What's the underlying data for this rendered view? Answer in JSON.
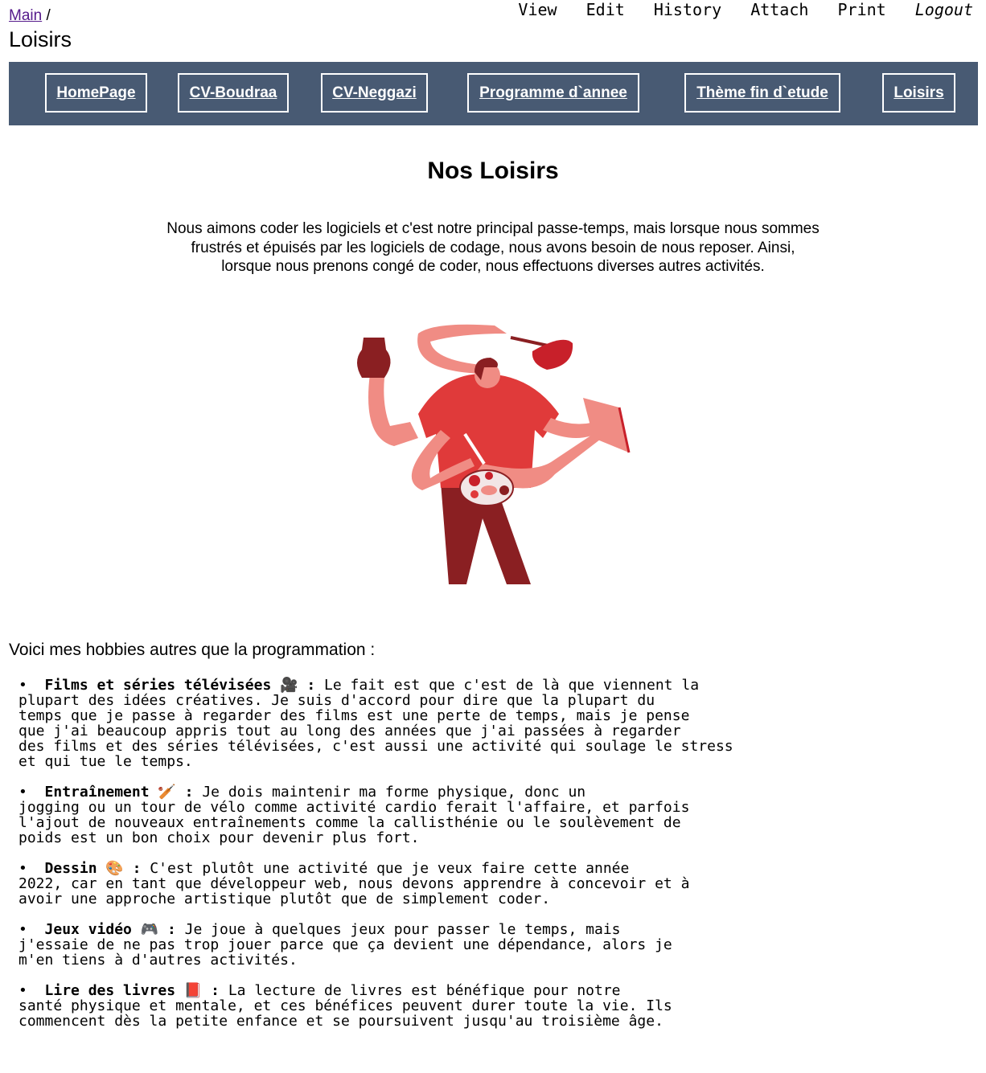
{
  "breadcrumb": {
    "root": "Main",
    "sep": " /"
  },
  "page_title": "Loisirs",
  "actions": [
    "View",
    "Edit",
    "History",
    "Attach",
    "Print",
    "Logout"
  ],
  "nav": [
    "HomePage",
    "CV-Boudraa",
    "CV-Neggazi",
    "Programme d`annee",
    "Thème fin d`etude",
    "Loisirs"
  ],
  "heading": "Nos Loisirs",
  "intro": [
    "Nous aimons coder les logiciels et c'est notre principal passe-temps, mais lorsque nous sommes",
    "frustrés et épuisés par les logiciels de codage, nous avons besoin de nous reposer. Ainsi,",
    "lorsque nous prenons congé de coder, nous effectuons diverses autres activités."
  ],
  "lead": "Voici mes hobbies autres que la programmation :",
  "hobbies": [
    {
      "title": "Films et séries télévisées 🎥 :",
      "lines": [
        " Le fait est que c'est de là que viennent la",
        "plupart des idées créatives. Je suis d'accord pour dire que la plupart du",
        "temps que je passe à regarder des films est une perte de temps, mais je pense",
        "que j'ai beaucoup appris tout au long des années que j'ai passées à regarder",
        "des films et des séries télévisées, c'est aussi une activité qui soulage le stress",
        "et qui tue le temps."
      ]
    },
    {
      "title": "Entraînement 🏏 :",
      "lines": [
        " Je dois maintenir ma forme physique, donc un",
        "jogging ou un tour de vélo comme activité cardio ferait l'affaire, et parfois",
        "l'ajout de nouveaux entraînements comme la callisthénie ou le soulèvement de",
        "poids est un bon choix pour devenir plus fort."
      ]
    },
    {
      "title": "Dessin 🎨 :",
      "lines": [
        " C'est plutôt une activité que je veux faire cette année",
        "2022, car en tant que développeur web, nous devons apprendre à concevoir et à",
        "avoir une approche artistique plutôt que de simplement coder."
      ]
    },
    {
      "title": "Jeux vidéo 🎮 :",
      "lines": [
        " Je joue à quelques jeux pour passer le temps, mais",
        "j'essaie de ne pas trop jouer parce que ça devient une dépendance, alors je",
        "m'en tiens à d'autres activités."
      ]
    },
    {
      "title": "Lire des livres 📕 :",
      "lines": [
        " La lecture de livres est bénéfique pour notre",
        "santé physique et mentale, et ces bénéfices peuvent durer toute la vie. Ils",
        "commencent dès la petite enfance et se poursuivent jusqu'au troisième âge."
      ]
    }
  ],
  "colors": {
    "nav_bg": "#485a73",
    "illus_red": "#e03a3a",
    "illus_pink": "#f08c84",
    "illus_dark": "#8a1f22"
  }
}
